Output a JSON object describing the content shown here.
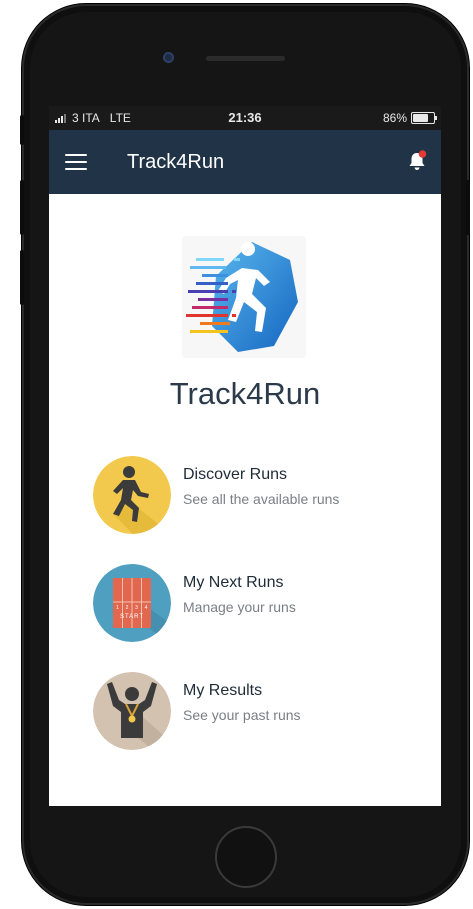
{
  "status_bar": {
    "carrier": "3 ITA",
    "network": "LTE",
    "time": "21:36",
    "battery_percent": "86%",
    "battery_level": 0.86
  },
  "app_bar": {
    "title": "Track4Run",
    "menu_icon": "hamburger-menu-icon",
    "notification_icon": "bell-icon"
  },
  "brand": {
    "name": "Track4Run"
  },
  "menu": [
    {
      "title": "Discover Runs",
      "subtitle": "See all the available runs",
      "icon": "runner-icon"
    },
    {
      "title": "My Next Runs",
      "subtitle": "Manage your runs",
      "icon": "track-start-icon",
      "icon_text": "START"
    },
    {
      "title": "My Results",
      "subtitle": "See your past runs",
      "icon": "medal-winner-icon"
    }
  ],
  "colors": {
    "app_bar": "#213447",
    "notification_dot": "#e53935",
    "discover_bg": "#f2c94c",
    "next_runs_bg": "#4f9fc0",
    "results_bg": "#d3c2b0"
  }
}
